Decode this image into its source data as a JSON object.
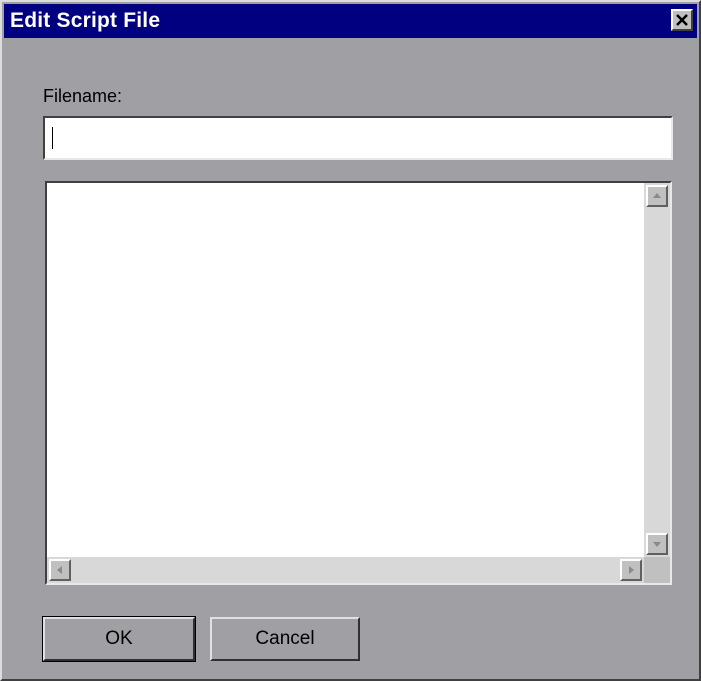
{
  "window": {
    "title": "Edit Script File",
    "close_icon": "close-x-icon"
  },
  "form": {
    "filename_label": "Filename:",
    "filename_value": "",
    "script_content": ""
  },
  "buttons": {
    "ok_label": "OK",
    "cancel_label": "Cancel"
  },
  "colors": {
    "titlebar": "#000080",
    "dialog_face": "#a0a0a4",
    "field_background": "#ffffff"
  }
}
